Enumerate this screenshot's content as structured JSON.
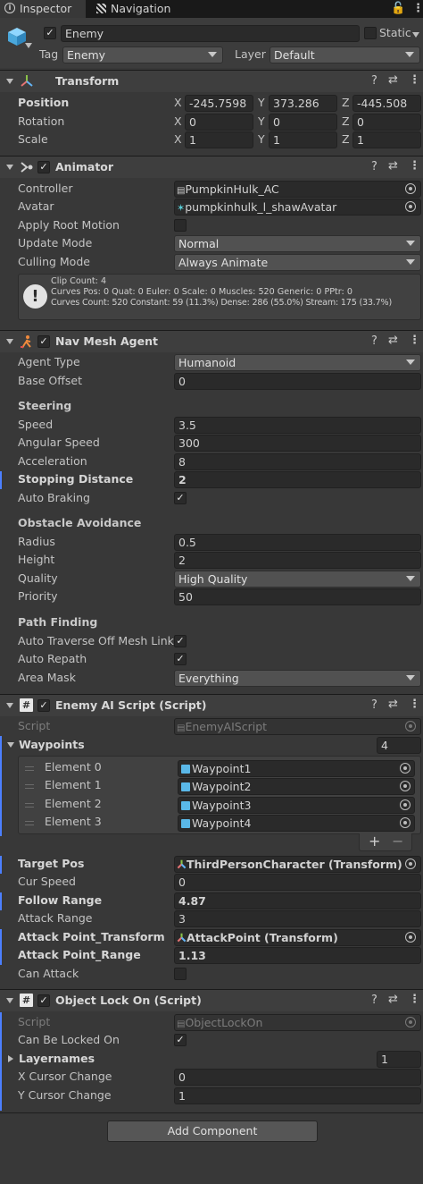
{
  "tabs": {
    "inspector": "Inspector",
    "navigation": "Navigation"
  },
  "gameobject": {
    "name": "Enemy",
    "static_label": "Static",
    "tag_label": "Tag",
    "tag_value": "Enemy",
    "layer_label": "Layer",
    "layer_value": "Default"
  },
  "transform": {
    "title": "Transform",
    "position_label": "Position",
    "rotation_label": "Rotation",
    "scale_label": "Scale",
    "axes": [
      "X",
      "Y",
      "Z"
    ],
    "position": [
      "-245.7598",
      "373.286",
      "-445.508"
    ],
    "rotation": [
      "0",
      "0",
      "0"
    ],
    "scale": [
      "1",
      "1",
      "1"
    ]
  },
  "animator": {
    "title": "Animator",
    "controller_label": "Controller",
    "controller_value": "PumpkinHulk_AC",
    "avatar_label": "Avatar",
    "avatar_value": "pumpkinhulk_l_shawAvatar",
    "apply_root_motion_label": "Apply Root Motion",
    "update_mode_label": "Update Mode",
    "update_mode_value": "Normal",
    "culling_mode_label": "Culling Mode",
    "culling_mode_value": "Always Animate",
    "info_line1": "Clip Count: 4",
    "info_line2": "Curves Pos: 0 Quat: 0 Euler: 0 Scale: 0 Muscles: 520 Generic: 0 PPtr: 0",
    "info_line3": "Curves Count: 520 Constant: 59 (11.3%) Dense: 286 (55.0%) Stream: 175 (33.7%)"
  },
  "navmesh": {
    "title": "Nav Mesh Agent",
    "agent_type_label": "Agent Type",
    "agent_type_value": "Humanoid",
    "base_offset_label": "Base Offset",
    "base_offset_value": "0",
    "steering_header": "Steering",
    "speed_label": "Speed",
    "speed_value": "3.5",
    "angular_speed_label": "Angular Speed",
    "angular_speed_value": "300",
    "acceleration_label": "Acceleration",
    "acceleration_value": "8",
    "stopping_distance_label": "Stopping Distance",
    "stopping_distance_value": "2",
    "auto_braking_label": "Auto Braking",
    "obstacle_header": "Obstacle Avoidance",
    "radius_label": "Radius",
    "radius_value": "0.5",
    "height_label": "Height",
    "height_value": "2",
    "quality_label": "Quality",
    "quality_value": "High Quality",
    "priority_label": "Priority",
    "priority_value": "50",
    "pathfinding_header": "Path Finding",
    "auto_traverse_label": "Auto Traverse Off Mesh Link",
    "auto_repath_label": "Auto Repath",
    "area_mask_label": "Area Mask",
    "area_mask_value": "Everything"
  },
  "enemy_ai": {
    "title": "Enemy AI Script (Script)",
    "script_label": "Script",
    "script_value": "EnemyAIScript",
    "waypoints_label": "Waypoints",
    "waypoints_count": "4",
    "elements": [
      {
        "label": "Element 0",
        "value": "Waypoint1"
      },
      {
        "label": "Element 1",
        "value": "Waypoint2"
      },
      {
        "label": "Element 2",
        "value": "Waypoint3"
      },
      {
        "label": "Element 3",
        "value": "Waypoint4"
      }
    ],
    "add_symbol": "+",
    "remove_symbol": "−",
    "target_pos_label": "Target Pos",
    "target_pos_value": "ThirdPersonCharacter (Transform)",
    "cur_speed_label": "Cur Speed",
    "cur_speed_value": "0",
    "follow_range_label": "Follow Range",
    "follow_range_value": "4.87",
    "attack_range_label": "Attack Range",
    "attack_range_value": "3",
    "attack_point_transform_label": "Attack Point_Transform",
    "attack_point_transform_value": "AttackPoint (Transform)",
    "attack_point_range_label": "Attack Point_Range",
    "attack_point_range_value": "1.13",
    "can_attack_label": "Can Attack"
  },
  "object_lock": {
    "title": "Object Lock On (Script)",
    "script_label": "Script",
    "script_value": "ObjectLockOn",
    "can_be_locked_label": "Can Be Locked On",
    "layernames_label": "Layernames",
    "layernames_count": "1",
    "x_cursor_label": "X Cursor Change",
    "x_cursor_value": "0",
    "y_cursor_label": "Y Cursor Change",
    "y_cursor_value": "1"
  },
  "add_component_label": "Add Component",
  "colors": {
    "accent": "#4c7fff",
    "background": "#383838",
    "field": "#2a2a2a",
    "header": "#3e3e3e"
  }
}
